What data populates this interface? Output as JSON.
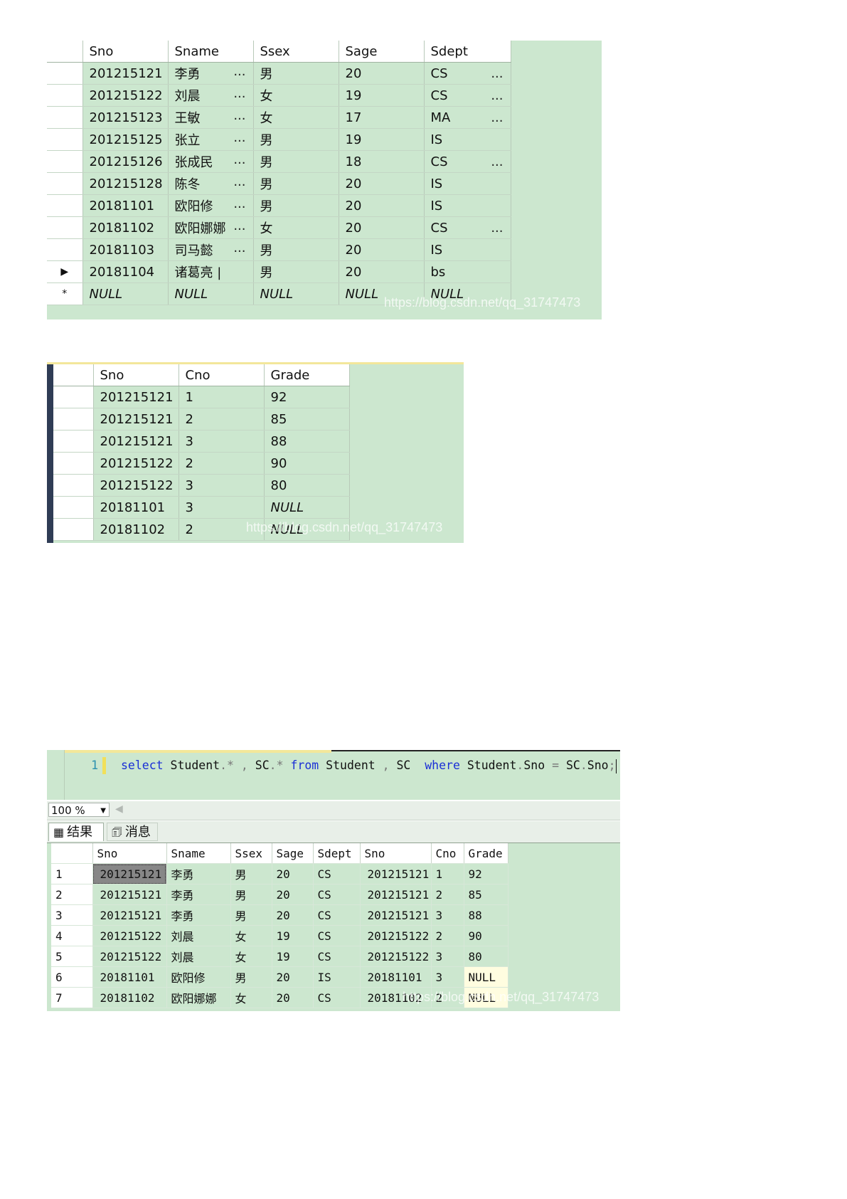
{
  "student_table": {
    "columns": [
      "Sno",
      "Sname",
      "Ssex",
      "Sage",
      "Sdept"
    ],
    "rows": [
      {
        "indicator": "",
        "cells": [
          "201215121",
          "李勇",
          "男",
          "20",
          "CS"
        ],
        "more": [
          true,
          false,
          true
        ]
      },
      {
        "indicator": "",
        "cells": [
          "201215122",
          "刘晨",
          "女",
          "19",
          "CS"
        ],
        "more": [
          true,
          false,
          true
        ]
      },
      {
        "indicator": "",
        "cells": [
          "201215123",
          "王敏",
          "女",
          "17",
          "MA"
        ],
        "more": [
          true,
          false,
          true
        ]
      },
      {
        "indicator": "",
        "cells": [
          "201215125",
          "张立",
          "男",
          "19",
          "IS"
        ],
        "more": [
          true,
          false,
          false
        ]
      },
      {
        "indicator": "",
        "cells": [
          "201215126",
          "张成民",
          "男",
          "18",
          "CS"
        ],
        "more": [
          true,
          false,
          true
        ]
      },
      {
        "indicator": "",
        "cells": [
          "201215128",
          "陈冬",
          "男",
          "20",
          "IS"
        ],
        "more": [
          true,
          false,
          false
        ]
      },
      {
        "indicator": "",
        "cells": [
          "20181101",
          "欧阳修",
          "男",
          "20",
          "IS"
        ],
        "more": [
          true,
          false,
          false
        ]
      },
      {
        "indicator": "",
        "cells": [
          "20181102",
          "欧阳娜娜",
          "女",
          "20",
          "CS"
        ],
        "more": [
          true,
          false,
          true
        ]
      },
      {
        "indicator": "",
        "cells": [
          "20181103",
          "司马懿",
          "男",
          "20",
          "IS"
        ],
        "more": [
          true,
          false,
          false
        ]
      },
      {
        "indicator": "▶",
        "cells": [
          "20181104",
          "诸葛亮 |",
          "男",
          "20",
          "bs"
        ],
        "more": [
          false,
          false,
          false
        ]
      },
      {
        "indicator": "*",
        "cells": [
          "NULL",
          "NULL",
          "NULL",
          "NULL",
          "NULL"
        ],
        "more": [
          false,
          false,
          false
        ],
        "is_null": true
      }
    ],
    "ellipsis": "...",
    "watermark": "https://blog.csdn.net/qq_31747473"
  },
  "sc_table": {
    "columns": [
      "Sno",
      "Cno",
      "Grade"
    ],
    "rows": [
      [
        "201215121",
        "1",
        "92"
      ],
      [
        "201215121",
        "2",
        "85"
      ],
      [
        "201215121",
        "3",
        "88"
      ],
      [
        "201215122",
        "2",
        "90"
      ],
      [
        "201215122",
        "3",
        "80"
      ],
      [
        "20181101",
        "3",
        "NULL"
      ],
      [
        "20181102",
        "2",
        "NULL"
      ]
    ],
    "watermark": "https://blog.csdn.net/qq_31747473"
  },
  "query_editor": {
    "line_number": "1",
    "tokens": [
      {
        "t": "select",
        "k": "kw"
      },
      {
        "t": " Student",
        "k": ""
      },
      {
        "t": ".",
        "k": "op"
      },
      {
        "t": "*",
        "k": "op"
      },
      {
        "t": " ",
        "k": ""
      },
      {
        "t": ",",
        "k": "op"
      },
      {
        "t": " SC",
        "k": ""
      },
      {
        "t": ".",
        "k": "op"
      },
      {
        "t": "*",
        "k": "op"
      },
      {
        "t": " ",
        "k": ""
      },
      {
        "t": "from",
        "k": "kw"
      },
      {
        "t": " Student ",
        "k": ""
      },
      {
        "t": ",",
        "k": "op"
      },
      {
        "t": " SC  ",
        "k": ""
      },
      {
        "t": "where",
        "k": "kw"
      },
      {
        "t": " Student",
        "k": ""
      },
      {
        "t": ".",
        "k": "op"
      },
      {
        "t": "Sno ",
        "k": ""
      },
      {
        "t": "=",
        "k": "op"
      },
      {
        "t": " SC",
        "k": ""
      },
      {
        "t": ".",
        "k": "op"
      },
      {
        "t": "Sno",
        "k": ""
      },
      {
        "t": ";",
        "k": "op"
      }
    ]
  },
  "zoom": {
    "value": "100 %"
  },
  "result_tabs": {
    "results_label": "结果",
    "messages_label": "消息"
  },
  "results": {
    "columns": [
      "",
      "Sno",
      "Sname",
      "Ssex",
      "Sage",
      "Sdept",
      "Sno",
      "Cno",
      "Grade"
    ],
    "rows": [
      [
        "1",
        "201215121",
        "李勇",
        "男",
        "20",
        "CS",
        "201215121",
        "1",
        "92"
      ],
      [
        "2",
        "201215121",
        "李勇",
        "男",
        "20",
        "CS",
        "201215121",
        "2",
        "85"
      ],
      [
        "3",
        "201215121",
        "李勇",
        "男",
        "20",
        "CS",
        "201215121",
        "3",
        "88"
      ],
      [
        "4",
        "201215122",
        "刘晨",
        "女",
        "19",
        "CS",
        "201215122",
        "2",
        "90"
      ],
      [
        "5",
        "201215122",
        "刘晨",
        "女",
        "19",
        "CS",
        "201215122",
        "3",
        "80"
      ],
      [
        "6",
        "20181101",
        "欧阳修",
        "男",
        "20",
        "IS",
        "20181101",
        "3",
        "NULL"
      ],
      [
        "7",
        "20181102",
        "欧阳娜娜",
        "女",
        "20",
        "CS",
        "20181102",
        "2",
        "NULL"
      ]
    ],
    "watermark": "https://blog.csdn.net/qq_31747473"
  },
  "colors": {
    "grid_bg": "#cce7cf",
    "keyword": "#1a2fd6",
    "selected_cell": "#878787",
    "null_cell": "#fffde0"
  }
}
